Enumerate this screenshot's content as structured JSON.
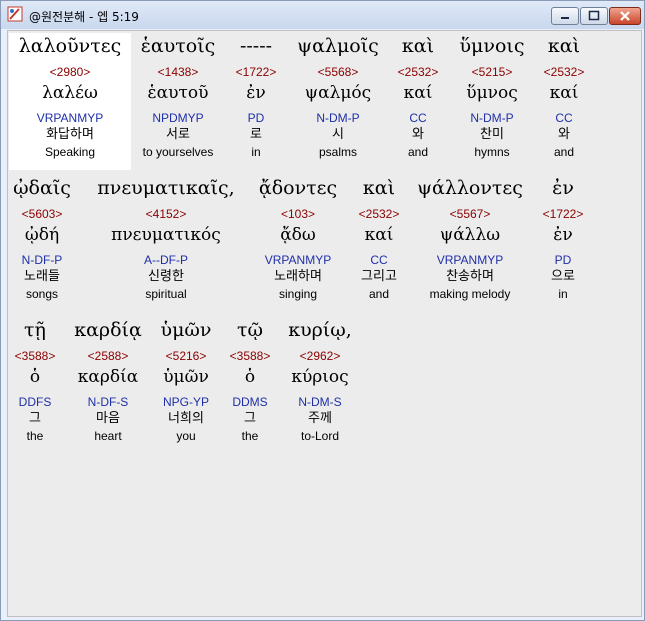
{
  "window": {
    "title": "@원전분해 - 엡 5:19"
  },
  "rows": [
    [
      {
        "greek": "λαλοῦντες",
        "strong": "<2980>",
        "lemma": "λαλέω",
        "parse": "VRPANMYP",
        "korean": "화답하며",
        "english": "Speaking"
      },
      {
        "greek": "ἑαυτοῖς",
        "strong": "<1438>",
        "lemma": "ἑαυτοῦ",
        "parse": "NPDMYP",
        "korean": "서로",
        "english": "to yourselves"
      },
      {
        "greek": "-----",
        "strong": "<1722>",
        "lemma": "ἐν",
        "parse": "PD",
        "korean": "로",
        "english": "in"
      },
      {
        "greek": "ψαλμοῖς",
        "strong": "<5568>",
        "lemma": "ψαλμός",
        "parse": "N-DM-P",
        "korean": "시",
        "english": "psalms"
      },
      {
        "greek": "καὶ",
        "strong": "<2532>",
        "lemma": "καί",
        "parse": "CC",
        "korean": "와",
        "english": "and"
      },
      {
        "greek": "ὕμνοις",
        "strong": "<5215>",
        "lemma": "ὕμνος",
        "parse": "N-DM-P",
        "korean": "찬미",
        "english": "hymns"
      },
      {
        "greek": "καὶ",
        "strong": "<2532>",
        "lemma": "καί",
        "parse": "CC",
        "korean": "와",
        "english": "and"
      }
    ],
    [
      {
        "greek": "ᾠδαῖς",
        "strong": "<5603>",
        "lemma": "ᾠδή",
        "parse": "N-DF-P",
        "korean": "노래들",
        "english": "songs"
      },
      {
        "greek": "πνευματικαῖς,",
        "strong": "<4152>",
        "lemma": "πνευματικός",
        "parse": "A--DF-P",
        "korean": "신령한",
        "english": "spiritual"
      },
      {
        "greek": "ᾄδοντες",
        "strong": "<103>",
        "lemma": "ᾄδω",
        "parse": "VRPANMYP",
        "korean": "노래하며",
        "english": "singing"
      },
      {
        "greek": "καὶ",
        "strong": "<2532>",
        "lemma": "καί",
        "parse": "CC",
        "korean": "그리고",
        "english": "and"
      },
      {
        "greek": "ψάλλοντες",
        "strong": "<5567>",
        "lemma": "ψάλλω",
        "parse": "VRPANMYP",
        "korean": "찬송하며",
        "english": "making melody"
      },
      {
        "greek": "ἐν",
        "strong": "<1722>",
        "lemma": "ἐν",
        "parse": "PD",
        "korean": "으로",
        "english": "in"
      }
    ],
    [
      {
        "greek": "τῇ",
        "strong": "<3588>",
        "lemma": "ὁ",
        "parse": "DDFS",
        "korean": "그",
        "english": "the"
      },
      {
        "greek": "καρδίᾳ",
        "strong": "<2588>",
        "lemma": "καρδία",
        "parse": "N-DF-S",
        "korean": "마음",
        "english": "heart"
      },
      {
        "greek": "ὑμῶν",
        "strong": "<5216>",
        "lemma": "ὑμῶν",
        "parse": "NPG-YP",
        "korean": "너희의",
        "english": "you"
      },
      {
        "greek": "τῷ",
        "strong": "<3588>",
        "lemma": "ὁ",
        "parse": "DDMS",
        "korean": "그",
        "english": "the"
      },
      {
        "greek": "κυρίῳ,",
        "strong": "<2962>",
        "lemma": "κύριος",
        "parse": "N-DM-S",
        "korean": "주께",
        "english": "to-Lord"
      }
    ]
  ]
}
